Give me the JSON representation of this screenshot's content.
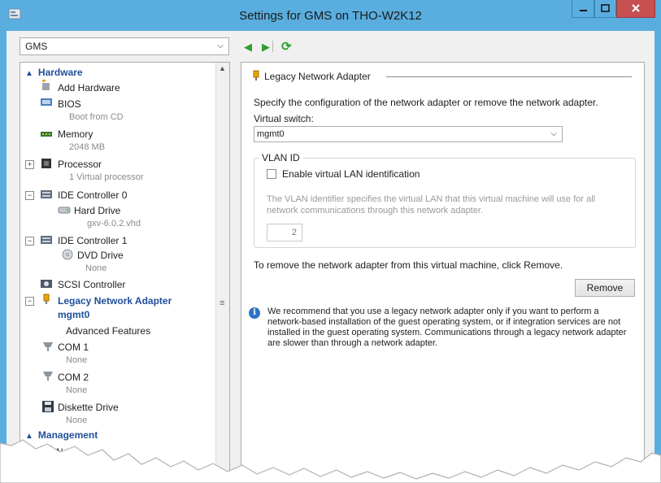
{
  "window": {
    "title": "Settings for GMS on THO-W2K12"
  },
  "vm_selector": {
    "value": "GMS"
  },
  "tree": {
    "hardware_header": "Hardware",
    "management_header": "Management",
    "items": [
      {
        "label": "Add Hardware"
      },
      {
        "label": "BIOS",
        "sub": "Boot from CD"
      },
      {
        "label": "Memory",
        "sub": "2048 MB"
      },
      {
        "label": "Processor",
        "sub": "1 Virtual processor"
      },
      {
        "label": "IDE Controller 0"
      },
      {
        "label": "Hard Drive",
        "sub": "gxv-6.0.2.vhd"
      },
      {
        "label": "IDE Controller 1"
      },
      {
        "label": "DVD Drive",
        "sub": "None"
      },
      {
        "label": "SCSI Controller"
      },
      {
        "label": "Legacy Network Adapter",
        "sub": "mgmt0"
      },
      {
        "label": "Advanced Features"
      },
      {
        "label": "COM 1",
        "sub": "None"
      },
      {
        "label": "COM 2",
        "sub": "None"
      },
      {
        "label": "Diskette Drive",
        "sub": "None"
      },
      {
        "label": "Name"
      }
    ]
  },
  "panel": {
    "heading": "Legacy Network Adapter",
    "intro": "Specify the configuration of the network adapter or remove the network adapter.",
    "virtual_switch_label": "Virtual switch:",
    "virtual_switch_value": "mgmt0",
    "vlan_group_title": "VLAN ID",
    "vlan_checkbox_label": "Enable virtual LAN identification",
    "vlan_help_line1": "The VLAN identifier specifies the virtual LAN that this virtual machine will use for all",
    "vlan_help_line2": "network communications through this network adapter.",
    "vlan_id_value": "2",
    "remove_help": "To remove the network adapter from this virtual machine, click Remove.",
    "remove_button": "Remove",
    "info_text": "We recommend that you use a legacy network adapter only if you want to perform a network-based installation of the guest operating system, or if integration services are not installed in the guest operating system. Communications through a legacy network adapter are slower than through a network adapter."
  },
  "colors": {
    "titlebar": "#5aaedf",
    "selection_text": "#1f4e9b",
    "close_button": "#c75050"
  }
}
